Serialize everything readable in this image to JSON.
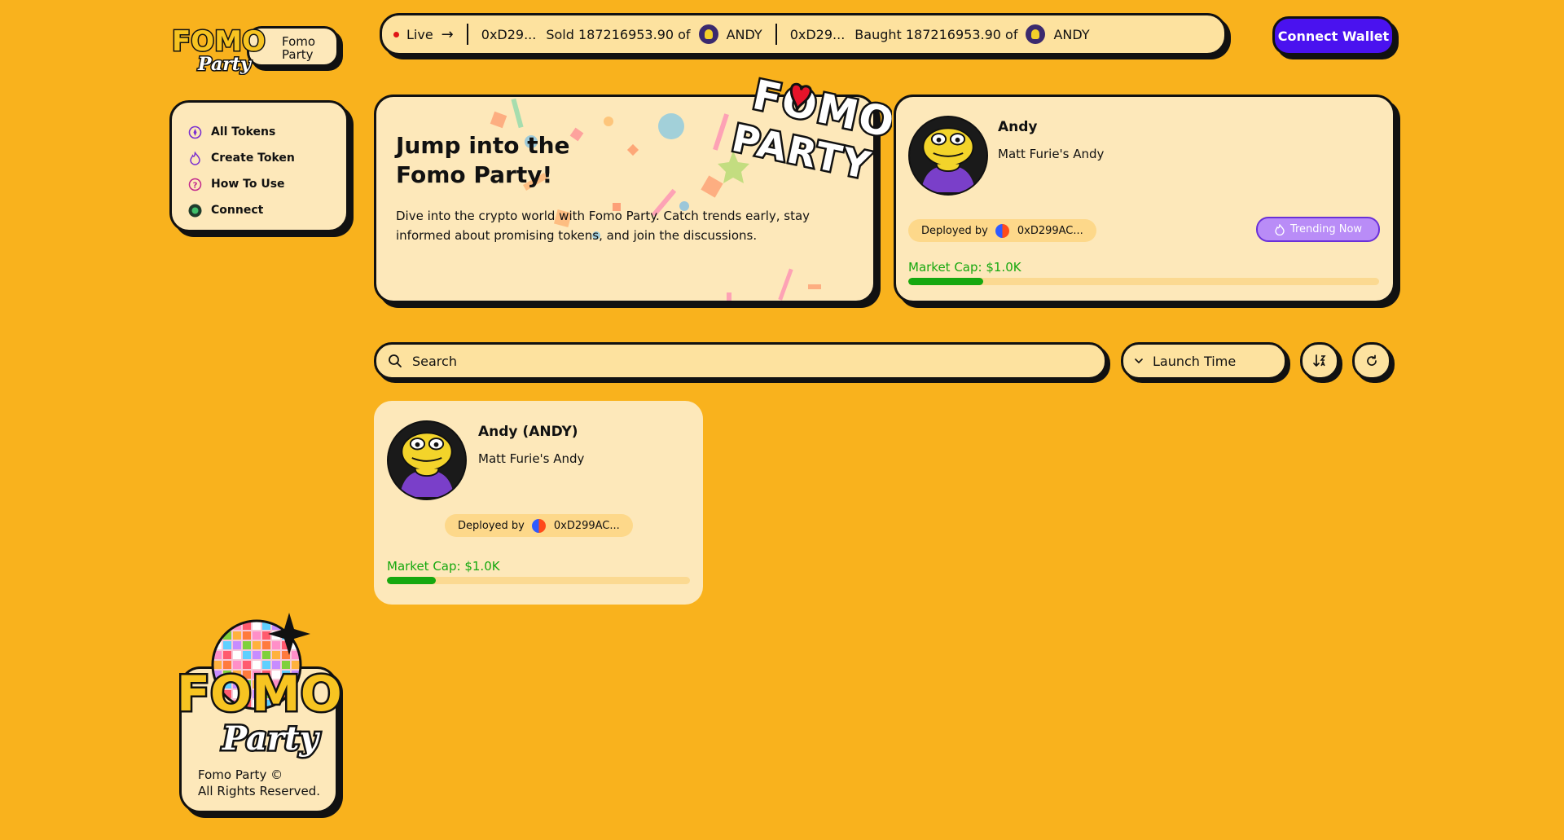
{
  "brand": {
    "name_line1": "Fomo",
    "name_line2": "Party",
    "logo_word": "FOMO",
    "logo_sub": "Party"
  },
  "ticker": {
    "live_label": "Live",
    "events": [
      {
        "addr": "0xD29...",
        "action": "Sold 187216953.90 of",
        "token": "ANDY"
      },
      {
        "addr": "0xD29...",
        "action": "Baught 187216953.90 of",
        "token": "ANDY"
      }
    ]
  },
  "header": {
    "connect_label": "Connect Wallet"
  },
  "sidebar": {
    "items": [
      {
        "label": "All Tokens"
      },
      {
        "label": "Create Token"
      },
      {
        "label": "How To Use"
      },
      {
        "label": "Connect"
      }
    ]
  },
  "hero": {
    "title": "Jump into the Fomo Party!",
    "description": "Dive into the crypto world with Fomo Party. Catch trends early, stay informed about promising tokens, and join the discussions.",
    "logo_top": "FOMO",
    "logo_bottom": "PARTY"
  },
  "featured": {
    "name": "Andy",
    "description": "Matt Furie's Andy",
    "deployed_label": "Deployed by",
    "deployer": "0xD299AC...",
    "trending_label": "Trending Now",
    "market_cap": "Market Cap: $1.0K",
    "progress": 0.16
  },
  "toolbar": {
    "search_placeholder": "Search",
    "sort_value": "Launch Time"
  },
  "tokens": [
    {
      "name": "Andy (ANDY)",
      "description": "Matt Furie's Andy",
      "deployed_label": "Deployed by",
      "deployer": "0xD299AC...",
      "market_cap": "Market Cap: $1.0K",
      "progress": 0.16
    }
  ],
  "footer": {
    "line1": "Fomo Party ©",
    "line2": "All Rights Reserved."
  },
  "colors": {
    "background": "#f9b21d",
    "card": "#fde8ba",
    "accent": "#4a12ef",
    "positive": "#16a80f",
    "trending": "#b98cf7"
  }
}
